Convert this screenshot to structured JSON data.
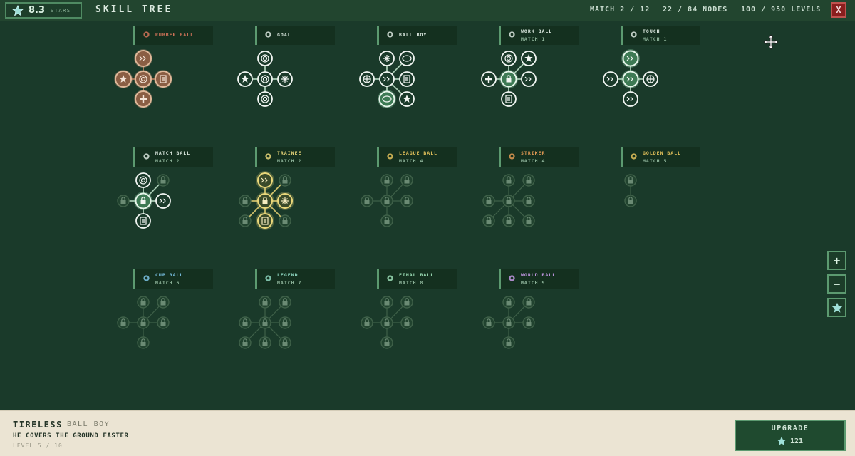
{
  "topbar": {
    "stars_value": "8.3",
    "stars_label": "STARS",
    "title": "SKILL TREE",
    "match": "MATCH 2 / 12",
    "nodes": "22 / 84 NODES",
    "levels": "100 / 950 LEVELS",
    "close_label": "X"
  },
  "trees": [
    {
      "name": "RUBBER BALL",
      "sub": "",
      "color": "#d4745a",
      "icon": "rubber-ball-icon"
    },
    {
      "name": "GOAL",
      "sub": "",
      "color": "#dce8e0",
      "icon": "goal-icon"
    },
    {
      "name": "BALL BOY",
      "sub": "",
      "color": "#dce8e0",
      "icon": "ball-boy-icon"
    },
    {
      "name": "WORK BALL",
      "sub": "MATCH 1",
      "color": "#dce8e0",
      "icon": "work-ball-icon"
    },
    {
      "name": "TOUCH",
      "sub": "MATCH 1",
      "color": "#dce8e0",
      "icon": "touch-icon"
    },
    {
      "name": "MATCH BALL",
      "sub": "MATCH 2",
      "color": "#dce8e0",
      "icon": "match-ball-icon"
    },
    {
      "name": "TRAINEE",
      "sub": "MATCH 2",
      "color": "#e9d77a",
      "icon": "trainee-icon"
    },
    {
      "name": "LEAGUE BALL",
      "sub": "MATCH 4",
      "color": "#e6c35c",
      "icon": "league-ball-icon"
    },
    {
      "name": "STRIKER",
      "sub": "MATCH 4",
      "color": "#e39a54",
      "icon": "striker-icon"
    },
    {
      "name": "GOLDEN BALL",
      "sub": "MATCH 5",
      "color": "#e6c35c",
      "icon": "golden-ball-icon"
    },
    {
      "name": "CUP BALL",
      "sub": "MATCH 6",
      "color": "#7cc4e8",
      "icon": "cup-ball-icon"
    },
    {
      "name": "LEGEND",
      "sub": "MATCH 7",
      "color": "#8fd8c2",
      "icon": "legend-icon"
    },
    {
      "name": "FINAL BALL",
      "sub": "MATCH 8",
      "color": "#9ee0b8",
      "icon": "final-ball-icon"
    },
    {
      "name": "WORLD BALL",
      "sub": "MATCH 9",
      "color": "#c79ae8",
      "icon": "world-ball-icon"
    }
  ],
  "zoom": {
    "in": "+",
    "out": "−"
  },
  "selected": {
    "name": "TIRELESS",
    "tree": "BALL BOY",
    "description": "HE COVERS THE GROUND FASTER",
    "level": "LEVEL 5 / 10"
  },
  "upgrade": {
    "label": "UPGRADE",
    "cost": "121"
  },
  "colors": {
    "background": "#1a3a2a",
    "accent": "#5c9a70",
    "panel": "#ebe4d3",
    "close": "#8a1e1e"
  }
}
